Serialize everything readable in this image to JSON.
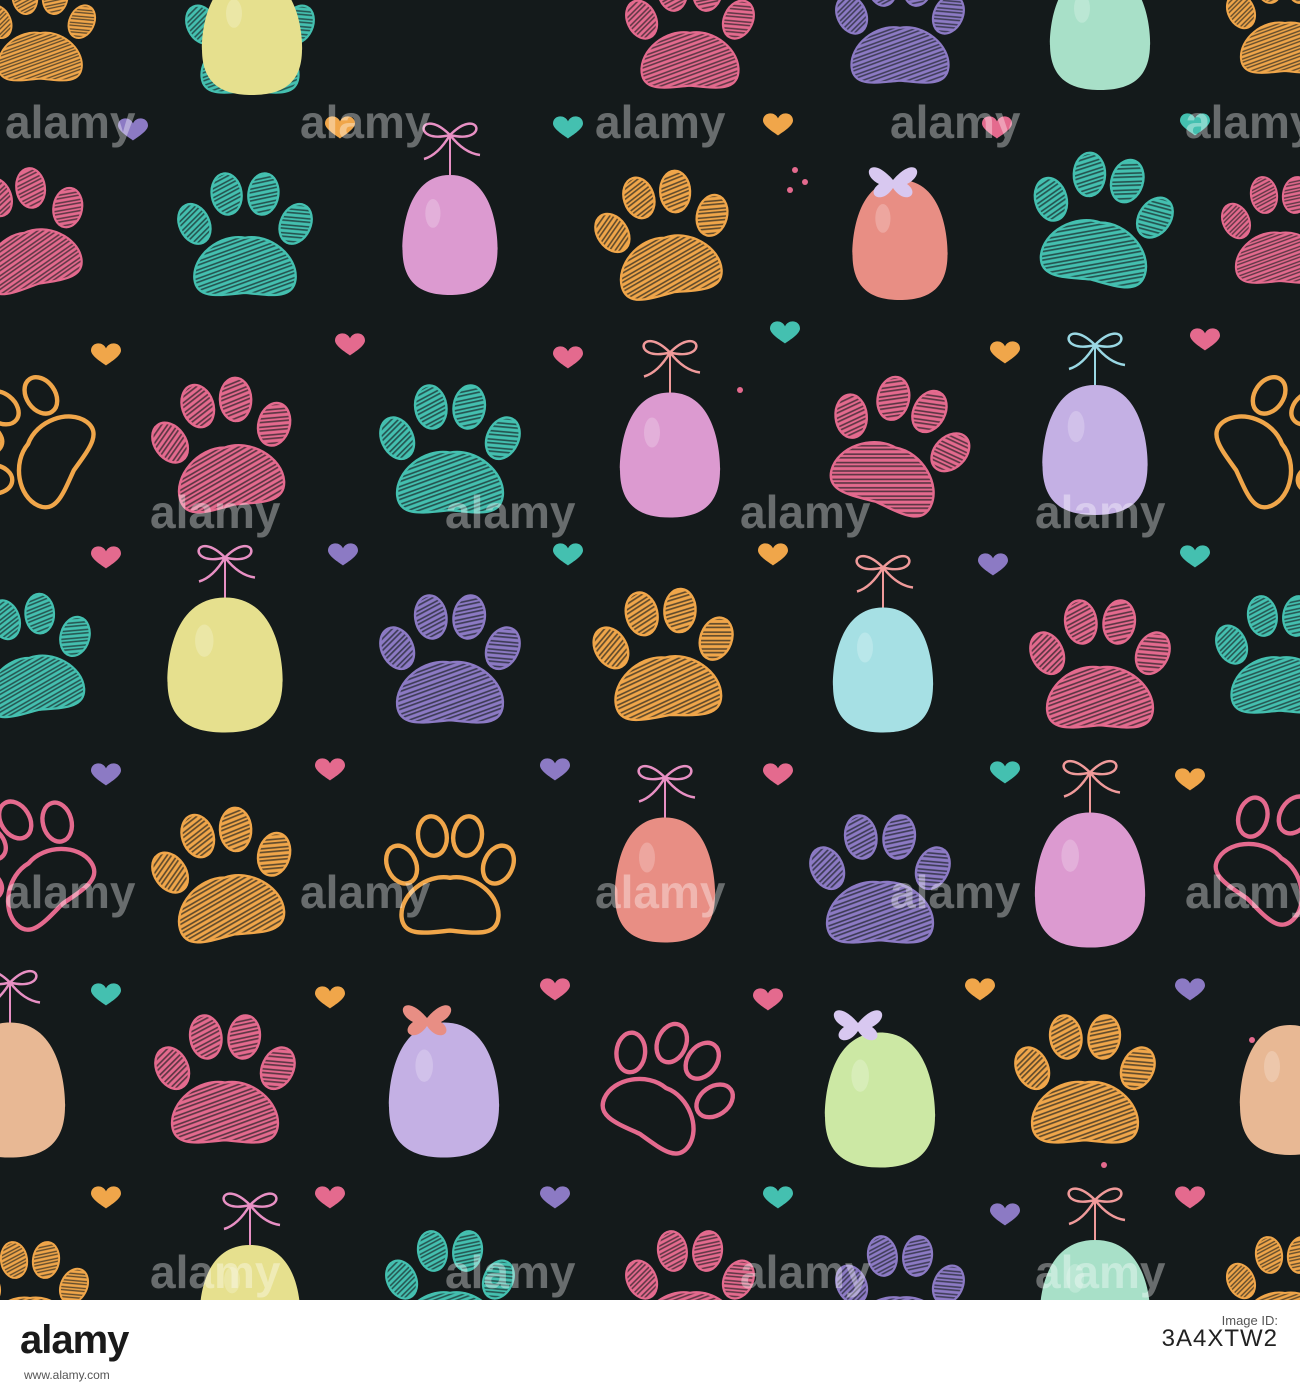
{
  "watermark": {
    "text": "alamy"
  },
  "footer": {
    "logo": "alamy",
    "image_id_label": "Image ID:",
    "image_id": "3A4XTW2",
    "url": "www.alamy.com"
  },
  "palette": {
    "background": "#141a1b",
    "pink": "#e46a8e",
    "teal": "#44c0b0",
    "orange": "#f0a64a",
    "purple": "#8c7ac4",
    "yellow_egg": "#e6e08e",
    "pink_egg": "#dc9ad0",
    "salmon_egg": "#e88e84",
    "lavender_egg": "#c4b0e4",
    "mint_egg": "#a8e0c8",
    "blue_egg": "#a6e0e4",
    "green_egg": "#cce8a4",
    "peach_egg": "#e8b894"
  },
  "icons": [
    "paw-print-icon",
    "easter-egg-icon",
    "heart-icon",
    "bow-icon",
    "butterfly-icon"
  ]
}
